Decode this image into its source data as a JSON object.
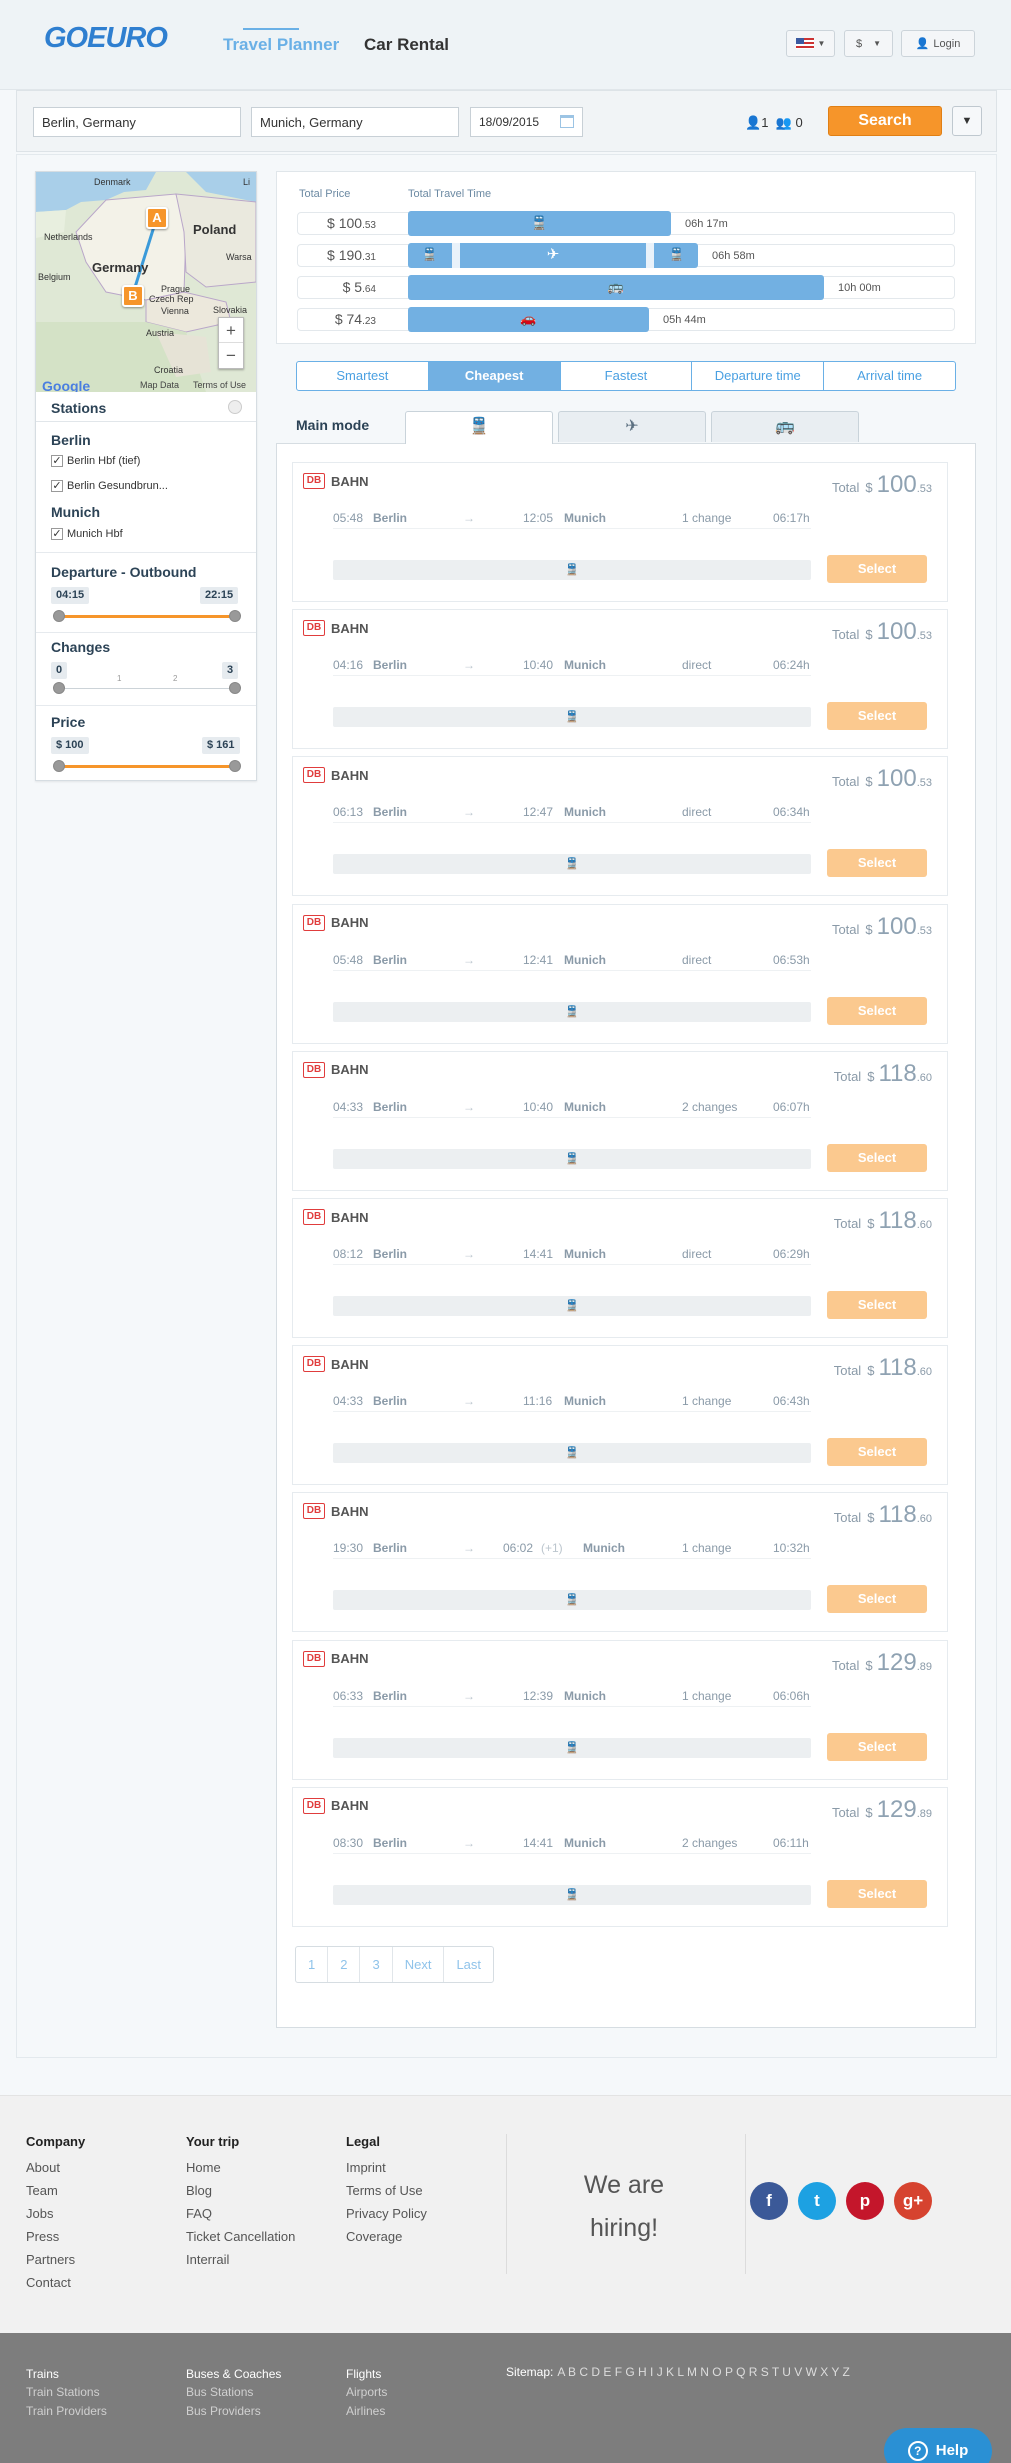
{
  "header": {
    "logo": "GOEURO",
    "nav": [
      {
        "label": "Travel Planner",
        "active": true
      },
      {
        "label": "Car Rental",
        "active": false
      }
    ],
    "currency": "$",
    "login": "Login"
  },
  "search": {
    "from": "Berlin, Germany",
    "to": "Munich, Germany",
    "date": "18/09/2015",
    "adults": "1",
    "children": "0",
    "button": "Search"
  },
  "map": {
    "labels": [
      "Denmark",
      "Poland",
      "Netherlands",
      "Germany",
      "Belgium",
      "Prague",
      "Czech Rep",
      "Vienna",
      "Austria",
      "Slovakia",
      "Croatia",
      "Warsa",
      "Li",
      "Google",
      "Map Data",
      "Terms of Use"
    ],
    "pins": [
      "A",
      "B"
    ],
    "zoom_in": "+",
    "zoom_out": "−"
  },
  "filters": {
    "stations_title": "Stations",
    "groups": [
      {
        "name": "Berlin",
        "items": [
          "Berlin Hbf (tief)",
          "Berlin Gesundbrun..."
        ]
      },
      {
        "name": "Munich",
        "items": [
          "Munich Hbf"
        ]
      }
    ],
    "departure": {
      "title": "Departure - Outbound",
      "min": "04:15",
      "max": "22:15"
    },
    "changes": {
      "title": "Changes",
      "min": "0",
      "max": "3",
      "ticks": [
        "1",
        "2"
      ]
    },
    "price": {
      "title": "Price",
      "min": "$ 100",
      "max": "$ 161"
    }
  },
  "summary": {
    "price_header": "Total Price",
    "time_header": "Total Travel Time",
    "rows": [
      {
        "mode": "train",
        "price": "$ 100",
        "cents": ".53",
        "time": "06h 17m",
        "fraction": 0.48
      },
      {
        "mode": "flight",
        "price": "$ 190",
        "cents": ".31",
        "time": "06h 58m",
        "fraction": 0.53
      },
      {
        "mode": "bus",
        "price": "$ 5",
        "cents": ".64",
        "time": "10h 00m",
        "fraction": 0.76
      },
      {
        "mode": "car",
        "price": "$ 74",
        "cents": ".23",
        "time": "05h 44m",
        "fraction": 0.44
      }
    ]
  },
  "sort": [
    "Smartest",
    "Cheapest",
    "Fastest",
    "Departure time",
    "Arrival time"
  ],
  "active_sort": "Cheapest",
  "main_mode_label": "Main mode",
  "results": [
    {
      "operator": "BAHN",
      "total_label": "Total",
      "currency": "$",
      "price": "100",
      "cents": ".53",
      "dep": "05:48",
      "from": "Berlin",
      "arr": "12:05",
      "arr_note": "",
      "to": "Munich",
      "changes": "1 change",
      "duration": "06:17h",
      "select": "Select"
    },
    {
      "operator": "BAHN",
      "total_label": "Total",
      "currency": "$",
      "price": "100",
      "cents": ".53",
      "dep": "04:16",
      "from": "Berlin",
      "arr": "10:40",
      "arr_note": "",
      "to": "Munich",
      "changes": "direct",
      "duration": "06:24h",
      "select": "Select"
    },
    {
      "operator": "BAHN",
      "total_label": "Total",
      "currency": "$",
      "price": "100",
      "cents": ".53",
      "dep": "06:13",
      "from": "Berlin",
      "arr": "12:47",
      "arr_note": "",
      "to": "Munich",
      "changes": "direct",
      "duration": "06:34h",
      "select": "Select"
    },
    {
      "operator": "BAHN",
      "total_label": "Total",
      "currency": "$",
      "price": "100",
      "cents": ".53",
      "dep": "05:48",
      "from": "Berlin",
      "arr": "12:41",
      "arr_note": "",
      "to": "Munich",
      "changes": "direct",
      "duration": "06:53h",
      "select": "Select"
    },
    {
      "operator": "BAHN",
      "total_label": "Total",
      "currency": "$",
      "price": "118",
      "cents": ".60",
      "dep": "04:33",
      "from": "Berlin",
      "arr": "10:40",
      "arr_note": "",
      "to": "Munich",
      "changes": "2 changes",
      "duration": "06:07h",
      "select": "Select"
    },
    {
      "operator": "BAHN",
      "total_label": "Total",
      "currency": "$",
      "price": "118",
      "cents": ".60",
      "dep": "08:12",
      "from": "Berlin",
      "arr": "14:41",
      "arr_note": "",
      "to": "Munich",
      "changes": "direct",
      "duration": "06:29h",
      "select": "Select"
    },
    {
      "operator": "BAHN",
      "total_label": "Total",
      "currency": "$",
      "price": "118",
      "cents": ".60",
      "dep": "04:33",
      "from": "Berlin",
      "arr": "11:16",
      "arr_note": "",
      "to": "Munich",
      "changes": "1 change",
      "duration": "06:43h",
      "select": "Select"
    },
    {
      "operator": "BAHN",
      "total_label": "Total",
      "currency": "$",
      "price": "118",
      "cents": ".60",
      "dep": "19:30",
      "from": "Berlin",
      "arr": "06:02",
      "arr_note": "(+1)",
      "to": "Munich",
      "changes": "1 change",
      "duration": "10:32h",
      "select": "Select"
    },
    {
      "operator": "BAHN",
      "total_label": "Total",
      "currency": "$",
      "price": "129",
      "cents": ".89",
      "dep": "06:33",
      "from": "Berlin",
      "arr": "12:39",
      "arr_note": "",
      "to": "Munich",
      "changes": "1 change",
      "duration": "06:06h",
      "select": "Select"
    },
    {
      "operator": "BAHN",
      "total_label": "Total",
      "currency": "$",
      "price": "129",
      "cents": ".89",
      "dep": "08:30",
      "from": "Berlin",
      "arr": "14:41",
      "arr_note": "",
      "to": "Munich",
      "changes": "2 changes",
      "duration": "06:11h",
      "select": "Select"
    }
  ],
  "pagination": [
    "1",
    "2",
    "3",
    "Next",
    "Last"
  ],
  "footer": {
    "columns": [
      {
        "title": "Company",
        "links": [
          "About",
          "Team",
          "Jobs",
          "Press",
          "Partners",
          "Contact"
        ]
      },
      {
        "title": "Your trip",
        "links": [
          "Home",
          "Blog",
          "FAQ",
          "Ticket Cancellation",
          "Interrail"
        ]
      },
      {
        "title": "Legal",
        "links": [
          "Imprint",
          "Terms of Use",
          "Privacy Policy",
          "Coverage"
        ]
      }
    ],
    "hiring": [
      "We are",
      "hiring!"
    ],
    "social": [
      "f",
      "t",
      "p",
      "g+"
    ]
  },
  "bottom_footer": {
    "columns": [
      {
        "title": "Trains",
        "links": [
          "Train Stations",
          "Train Providers"
        ]
      },
      {
        "title": "Buses & Coaches",
        "links": [
          "Bus Stations",
          "Bus Providers"
        ]
      },
      {
        "title": "Flights",
        "links": [
          "Airports",
          "Airlines"
        ]
      }
    ],
    "sitemap_label": "Sitemap:",
    "sitemap_letters": "A B C D E F G H I J K L M N O P Q R S T U V W X Y Z"
  },
  "help": "Help"
}
